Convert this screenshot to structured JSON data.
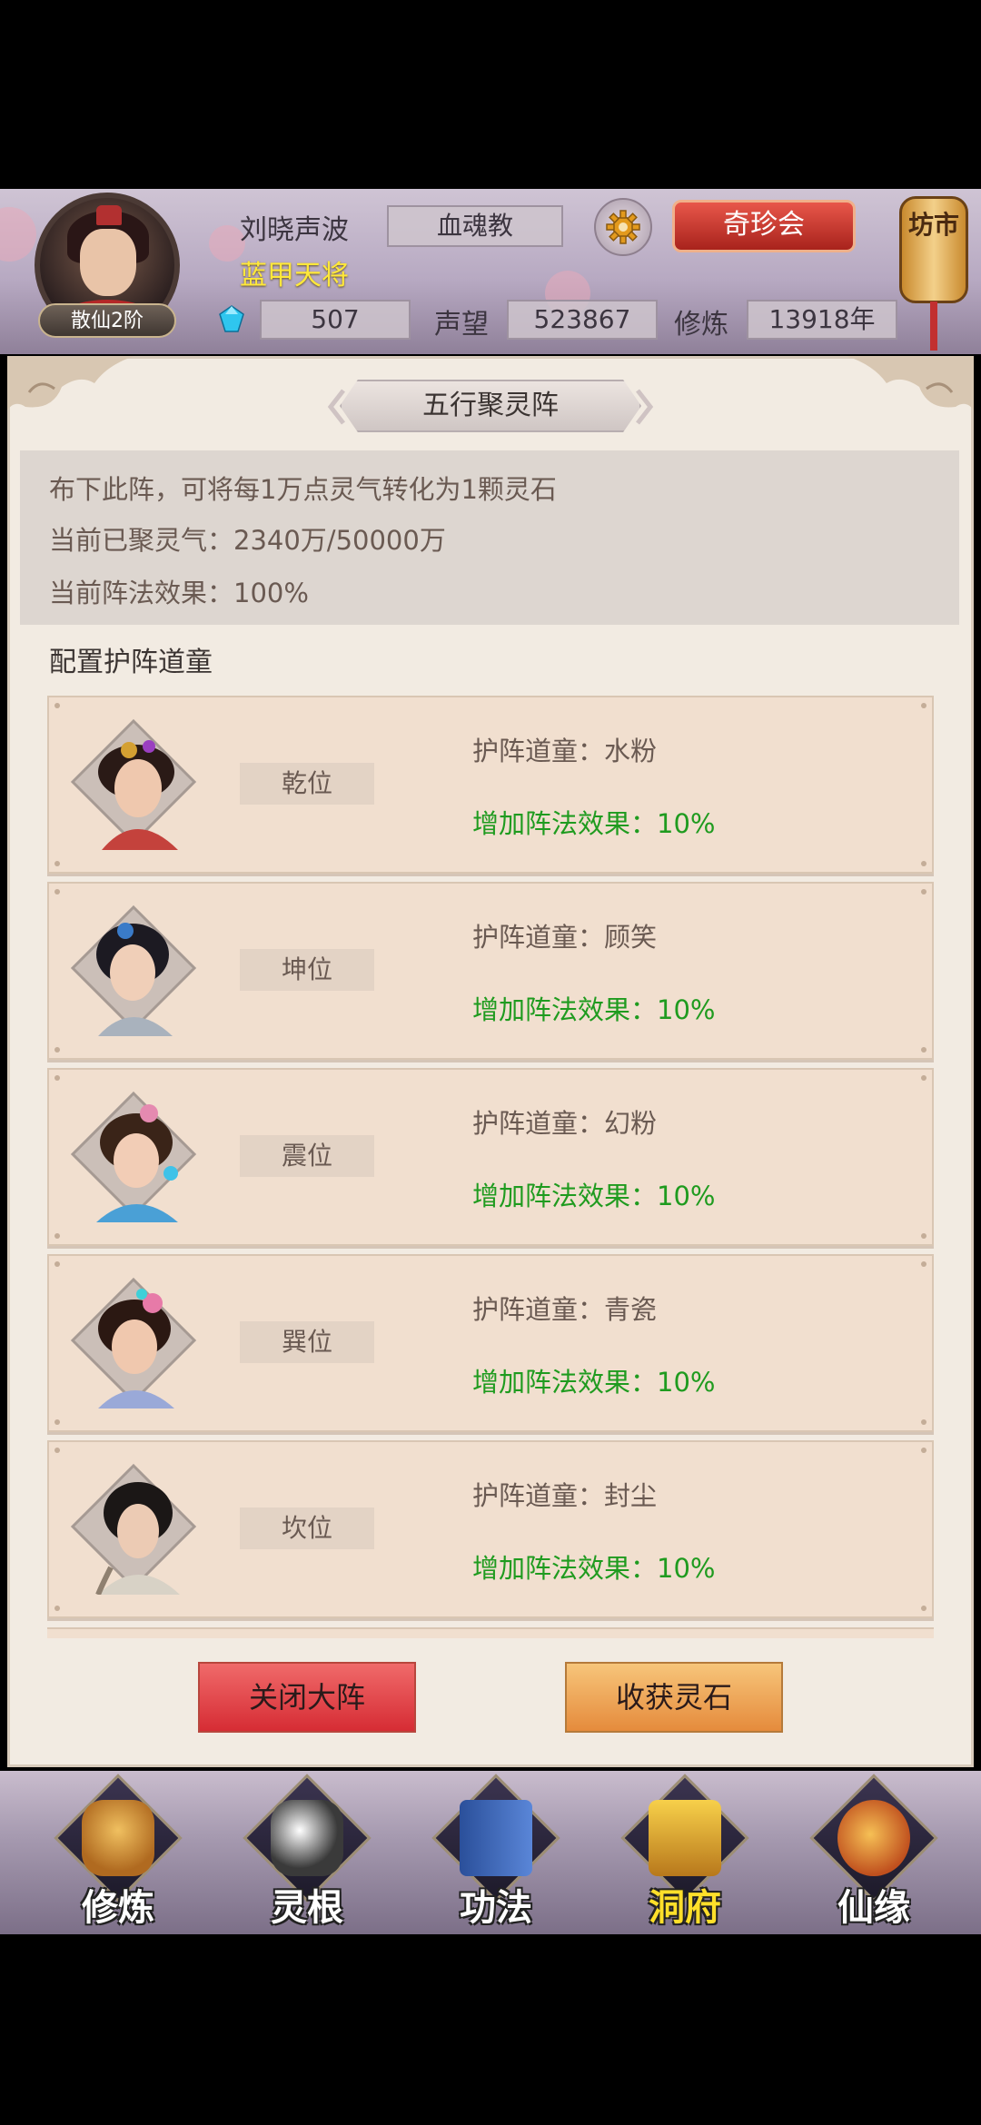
{
  "header": {
    "rank_badge": "散仙2阶",
    "player_name": "刘晓声波",
    "player_title": "蓝甲天将",
    "guild": "血魂教",
    "shop_button": "奇珍会",
    "market_label": "坊市",
    "gems": "507",
    "reputation_label": "声望",
    "reputation": "523867",
    "cultivation_label": "修炼",
    "cultivation": "13918年",
    "colors": {
      "title_yellow": "#ffe83a",
      "shop_red": "#c8322a"
    }
  },
  "panel": {
    "title": "五行聚灵阵",
    "info": {
      "line1": "布下此阵，可将每1万点灵气转化为1颗灵石",
      "line2": "当前已聚灵气：2340万/50000万",
      "line3": "当前阵法效果：100%"
    },
    "config_heading": "配置护阵道童",
    "guards": [
      {
        "position": "乾位",
        "name": "护阵道童：水粉",
        "bonus": "增加阵法效果：10%"
      },
      {
        "position": "坤位",
        "name": "护阵道童：顾笑",
        "bonus": "增加阵法效果：10%"
      },
      {
        "position": "震位",
        "name": "护阵道童：幻粉",
        "bonus": "增加阵法效果：10%"
      },
      {
        "position": "巽位",
        "name": "护阵道童：青瓷",
        "bonus": "增加阵法效果：10%"
      },
      {
        "position": "坎位",
        "name": "护阵道童：封尘",
        "bonus": "增加阵法效果：10%"
      }
    ],
    "close_button": "关闭大阵",
    "harvest_button": "收获灵石",
    "colors": {
      "bonus_green": "#1f9b1f"
    }
  },
  "nav": [
    {
      "label": "修炼",
      "icon": "hooded-monk-icon"
    },
    {
      "label": "灵根",
      "icon": "spirit-root-icon"
    },
    {
      "label": "功法",
      "icon": "scripture-book-icon"
    },
    {
      "label": "洞府",
      "icon": "cave-palace-icon",
      "active": true
    },
    {
      "label": "仙缘",
      "icon": "gourd-icon"
    }
  ]
}
